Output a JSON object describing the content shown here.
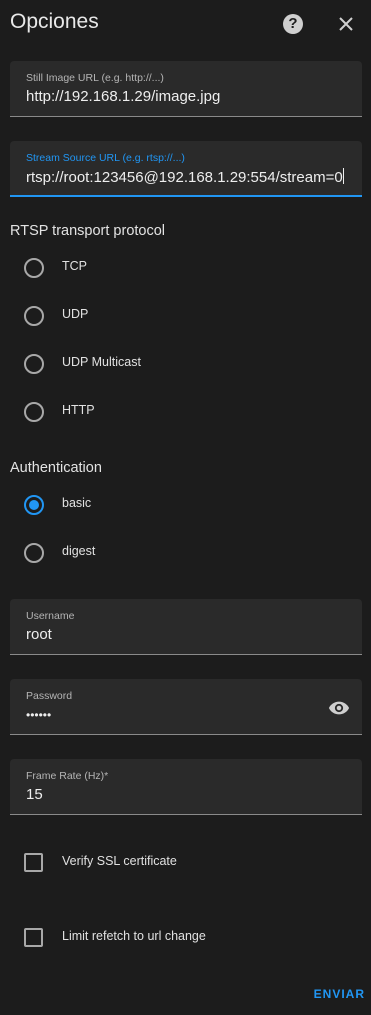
{
  "dialog": {
    "title": "Opciones"
  },
  "fields": {
    "still_image": {
      "label": "Still Image URL (e.g. http://...)",
      "value": "http://192.168.1.29/image.jpg"
    },
    "stream_source": {
      "label": "Stream Source URL (e.g. rtsp://...)",
      "value": "rtsp://root:123456@192.168.1.29:554/stream=0"
    },
    "username": {
      "label": "Username",
      "value": "root"
    },
    "password": {
      "label": "Password",
      "value": "••••••"
    },
    "frame_rate": {
      "label": "Frame Rate (Hz)*",
      "value": "15"
    }
  },
  "rtsp": {
    "title": "RTSP transport protocol",
    "options": [
      "TCP",
      "UDP",
      "UDP Multicast",
      "HTTP"
    ],
    "selected": ""
  },
  "auth": {
    "title": "Authentication",
    "options": [
      "basic",
      "digest"
    ],
    "selected": "basic"
  },
  "checkboxes": {
    "verify_ssl": "Verify SSL certificate",
    "limit_refetch": "Limit refetch to url change"
  },
  "submit_label": "ENVIAR",
  "accent_color": "#2196f3"
}
